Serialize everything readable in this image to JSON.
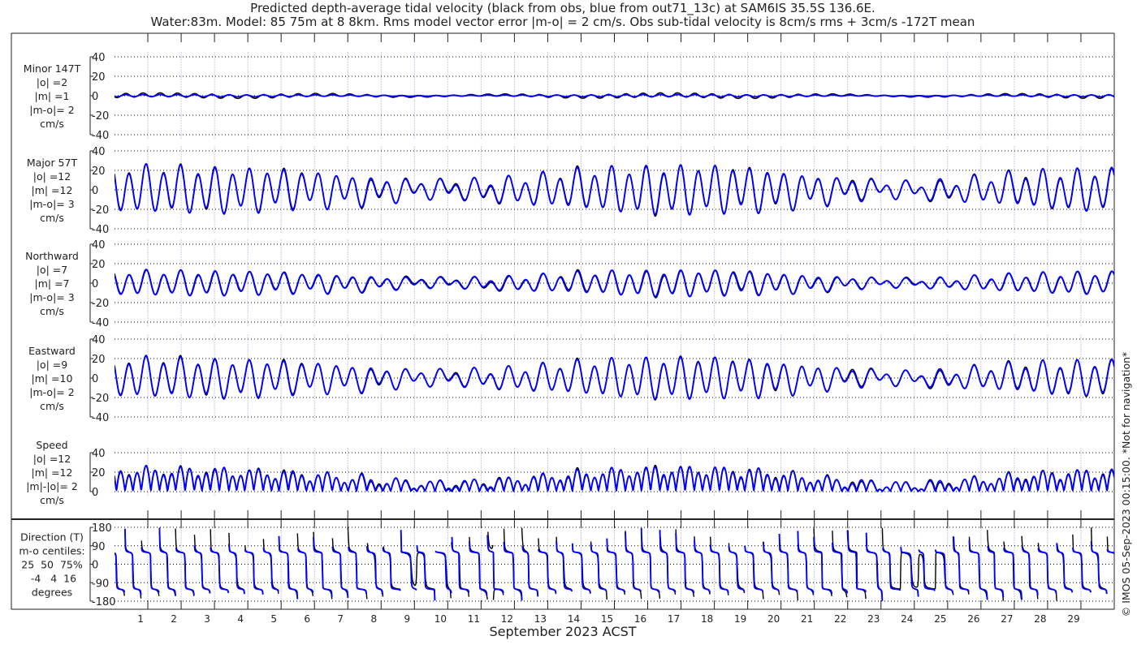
{
  "title": {
    "line1": "Predicted depth-average tidal velocity (black from obs, blue from out71_13c) at SAM6IS 35.5S 136.6E.",
    "line2": "Water:83m. Model: 85 75m at 8 8km. Rms model vector error |m-o| = 2 cm/s. Obs sub-tidal velocity is 8cm/s rms + 3cm/s -172T mean"
  },
  "footer_note": "© IMOS 05-Sep-2023 00:15:00. *Not for navigation*",
  "chart_data": {
    "type": "line",
    "title": "Predicted depth-average tidal velocity (black from obs, blue from out71_13c) at SAM6IS 35.5S 136.6E.",
    "xlabel": "September 2023 ACST",
    "xlim_days": [
      0,
      30
    ],
    "x_tick_labels": [
      "1",
      "2",
      "3",
      "4",
      "5",
      "6",
      "7",
      "8",
      "9",
      "10",
      "11",
      "12",
      "13",
      "14",
      "15",
      "16",
      "17",
      "18",
      "19",
      "20",
      "21",
      "22",
      "23",
      "24",
      "25",
      "26",
      "27",
      "28",
      "29"
    ],
    "grid": true,
    "series_names": [
      "obs",
      "out71_13c model"
    ],
    "colors": {
      "obs": "#000000",
      "model": "#0000ff",
      "grid": "#000000",
      "day_grid": "#c9c9e6"
    },
    "major_axis_bearing_deg": 57,
    "minor_axis_bearing_deg": 147,
    "major_daily_semidiurnal_amplitude_obs": [
      21,
      21,
      21,
      20,
      19,
      17,
      15,
      12,
      9,
      7,
      8,
      10,
      13,
      16,
      19,
      21,
      22,
      22,
      21,
      19,
      15,
      11,
      8,
      6,
      7,
      10,
      13,
      16,
      18,
      19
    ],
    "major_daily_semidiurnal_amplitude_model": [
      21,
      21,
      21,
      20,
      19,
      17,
      15,
      12,
      9,
      7,
      8,
      10,
      13,
      16,
      19,
      21,
      22,
      22,
      21,
      19,
      15,
      11,
      8,
      6,
      7,
      10,
      13,
      16,
      18,
      19
    ],
    "major_diurnal_amplitude": 5,
    "minor_amplitude_obs": 2,
    "minor_amplitude_model": 1,
    "panels": [
      {
        "id": "minor",
        "label_lines": [
          "Minor 147T",
          "|o| =2",
          "|m| =1",
          "|m-o|= 2",
          "cm/s"
        ],
        "ylim": [
          -40,
          40
        ],
        "yticks": [
          "40",
          "20",
          "0",
          "-20",
          "-40"
        ],
        "ytick_values": [
          40,
          20,
          0,
          -20,
          -40
        ]
      },
      {
        "id": "major",
        "label_lines": [
          "Major 57T",
          "|o| =12",
          "|m| =12",
          "|m-o|= 3",
          "cm/s"
        ],
        "ylim": [
          -40,
          40
        ],
        "yticks": [
          "40",
          "20",
          "0",
          "-20",
          "-40"
        ],
        "ytick_values": [
          40,
          20,
          0,
          -20,
          -40
        ]
      },
      {
        "id": "north",
        "label_lines": [
          "Northward",
          "|o| =7",
          "|m| =7",
          "|m-o|= 3",
          "cm/s"
        ],
        "ylim": [
          -40,
          40
        ],
        "yticks": [
          "40",
          "20",
          "0",
          "-20",
          "-40"
        ],
        "ytick_values": [
          40,
          20,
          0,
          -20,
          -40
        ]
      },
      {
        "id": "east",
        "label_lines": [
          "Eastward",
          "|o| =9",
          "|m| =10",
          "|m-o|= 2",
          "cm/s"
        ],
        "ylim": [
          -40,
          40
        ],
        "yticks": [
          "40",
          "20",
          "0",
          "-20",
          "-40"
        ],
        "ytick_values": [
          40,
          20,
          0,
          -20,
          -40
        ]
      },
      {
        "id": "speed",
        "label_lines": [
          "Speed",
          "|o| =12",
          "|m| =12",
          "|m|-|o|= 2",
          "cm/s"
        ],
        "ylim": [
          0,
          40
        ],
        "yticks": [
          "40",
          "20",
          "0"
        ],
        "ytick_values": [
          40,
          20,
          0
        ]
      },
      {
        "id": "direction",
        "label_lines": [
          "Direction (T)",
          "m-o centiles:",
          "25  50  75%",
          " -4   4  16",
          "degrees"
        ],
        "ylim": [
          -180,
          180
        ],
        "yticks": [
          "180",
          "90",
          "0",
          "-90",
          "-180"
        ],
        "ytick_values": [
          180,
          90,
          0,
          -90,
          -180
        ]
      }
    ]
  }
}
